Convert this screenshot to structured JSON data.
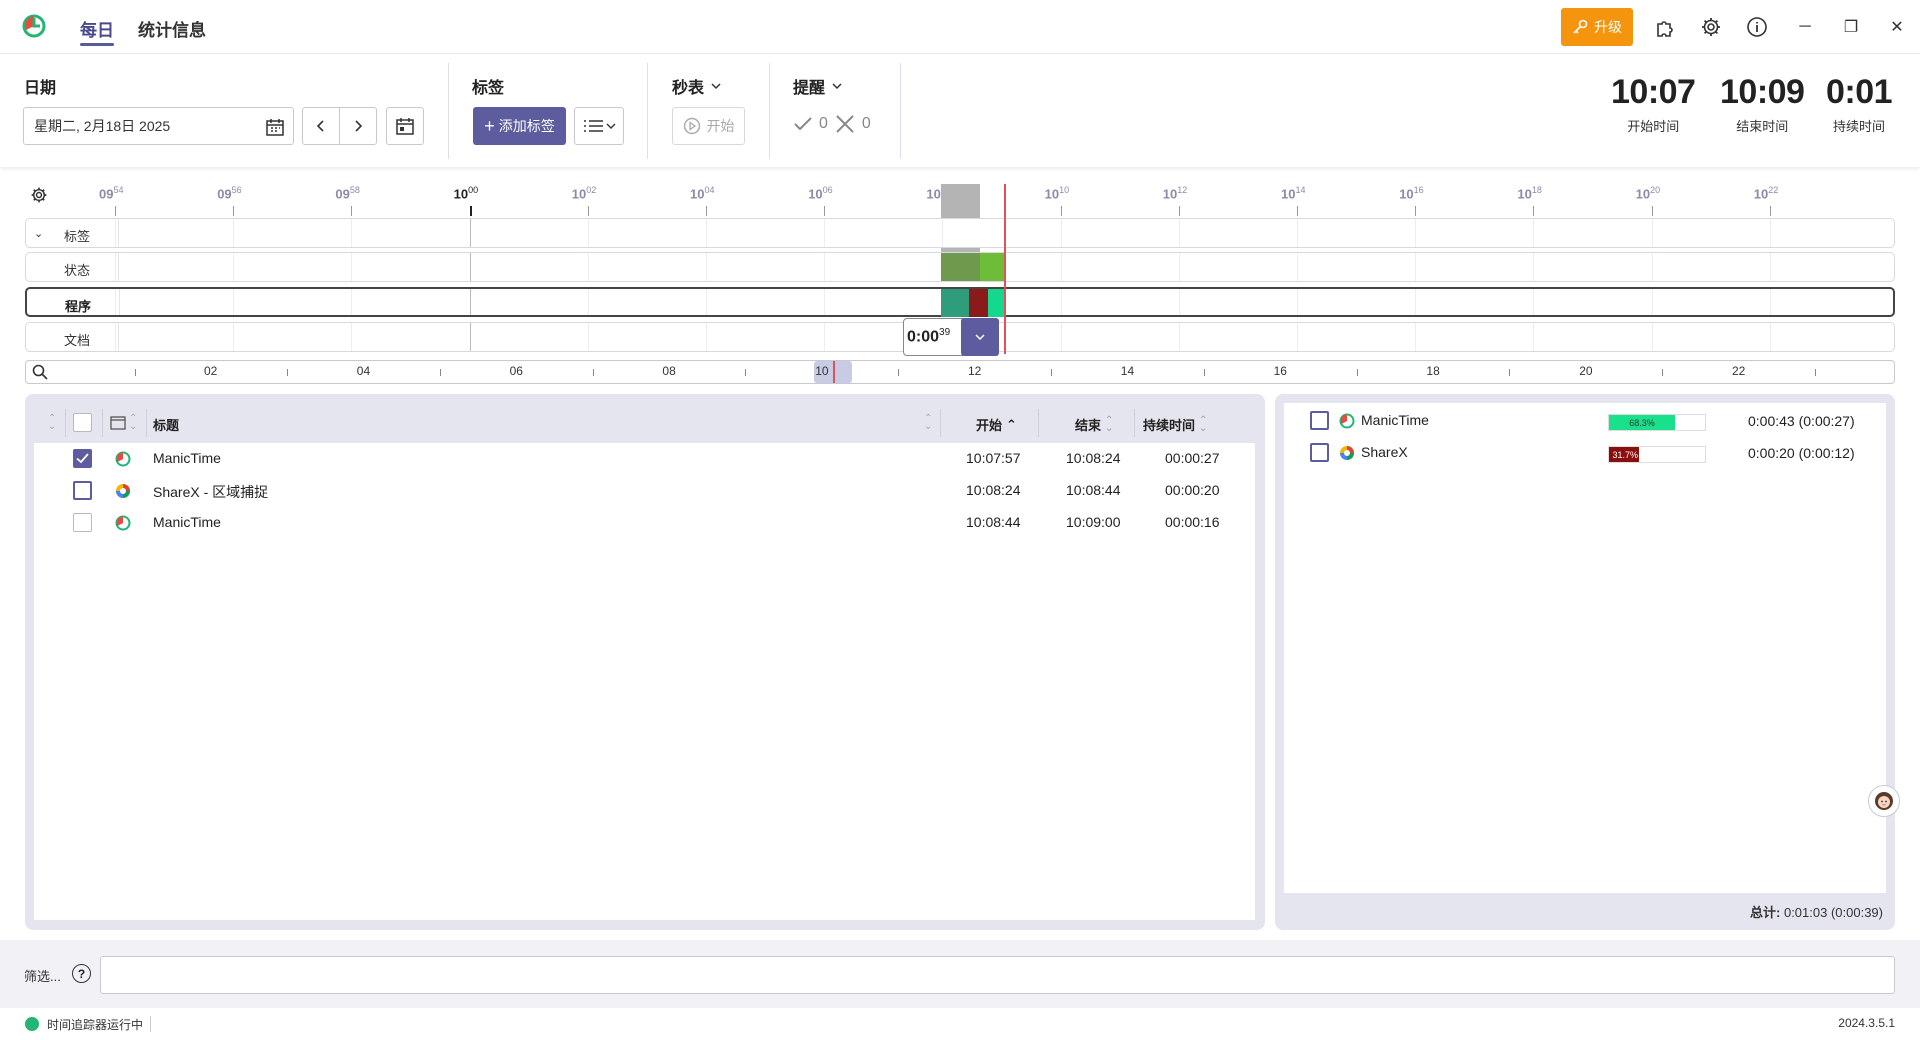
{
  "nav": {
    "tabs": [
      {
        "label": "每日"
      },
      {
        "label": "统计信息"
      }
    ]
  },
  "titlebar": {
    "upgrade_label": "升级"
  },
  "toolbar": {
    "date_label": "日期",
    "date_value": "星期二, 2月18日 2025",
    "tags_label": "标签",
    "add_tag_label": "添加标签",
    "stopwatch_label": "秒表",
    "start_label": "开始",
    "reminder_label": "提醒",
    "accepted_count": "0",
    "rejected_count": "0",
    "start_time": {
      "value": "10:07",
      "caption": "开始时间"
    },
    "end_time": {
      "value": "10:09",
      "caption": "结束时间"
    },
    "duration": {
      "value": "0:01",
      "caption": "持续时间"
    }
  },
  "timeline": {
    "ruler": [
      {
        "h": "09",
        "m": "54"
      },
      {
        "h": "09",
        "m": "56"
      },
      {
        "h": "09",
        "m": "58"
      },
      {
        "h": "10",
        "m": "00"
      },
      {
        "h": "10",
        "m": "02"
      },
      {
        "h": "10",
        "m": "04"
      },
      {
        "h": "10",
        "m": "06"
      },
      {
        "h": "10",
        "m": "08"
      },
      {
        "h": "10",
        "m": "10"
      },
      {
        "h": "10",
        "m": "12"
      },
      {
        "h": "10",
        "m": "14"
      },
      {
        "h": "10",
        "m": "16"
      },
      {
        "h": "10",
        "m": "18"
      },
      {
        "h": "10",
        "m": "20"
      },
      {
        "h": "10",
        "m": "22"
      }
    ],
    "tracks": [
      {
        "label": "标签"
      },
      {
        "label": "状态"
      },
      {
        "label": "程序"
      },
      {
        "label": "文档"
      }
    ],
    "tooltip": {
      "main": "0:00",
      "sup": "39"
    },
    "overview_labels": [
      "02",
      "04",
      "06",
      "08",
      "10",
      "12",
      "14",
      "16",
      "18",
      "20",
      "22"
    ],
    "colors": {
      "active_green": "#6aa84f",
      "manictime_teal": "#2bb38b",
      "sharex_red": "#8b1a1a",
      "now_line": "#e0525a"
    }
  },
  "table": {
    "headers": {
      "title": "标题",
      "start": "开始",
      "end": "结束",
      "duration": "持续时间"
    },
    "rows": [
      {
        "title": "ManicTime",
        "start": "10:07:57",
        "end": "10:08:24",
        "duration": "00:00:27",
        "checked": true,
        "icon": "manictime-icon"
      },
      {
        "title": "ShareX - 区域捕捉",
        "start": "10:08:24",
        "end": "10:08:44",
        "duration": "00:00:20",
        "checked": false,
        "icon": "sharex-icon"
      },
      {
        "title": "ManicTime",
        "start": "10:08:44",
        "end": "10:09:00",
        "duration": "00:00:16",
        "checked": false,
        "icon": "manictime-icon"
      }
    ]
  },
  "summary": {
    "rows": [
      {
        "name": "ManicTime",
        "percent": 68.3,
        "percent_label": "68.3%",
        "time": "0:00:43  (0:00:27)",
        "color": "#19e08a"
      },
      {
        "name": "ShareX",
        "percent": 31.7,
        "percent_label": "31.7%",
        "time": "0:00:20  (0:00:12)",
        "color": "#8b0e0e"
      }
    ],
    "total_label": "总计:",
    "total_value": "0:01:03  (0:00:39)"
  },
  "filter": {
    "label": "筛选...",
    "help": "?"
  },
  "status": {
    "text": "时间追踪器运行中",
    "version": "2024.3.5.1"
  }
}
